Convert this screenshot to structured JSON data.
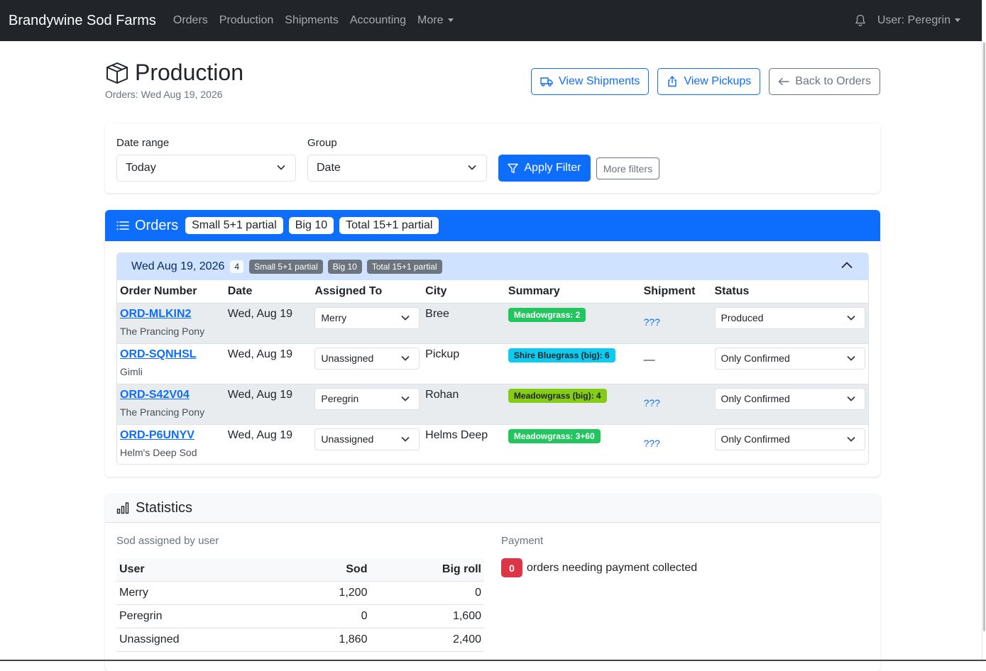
{
  "navbar": {
    "brand": "Brandywine Sod Farms",
    "links": [
      "Orders",
      "Production",
      "Shipments",
      "Accounting"
    ],
    "more_label": "More",
    "user_label": "User: Peregrin"
  },
  "header": {
    "title": "Production",
    "subtitle": "Orders: Wed Aug 19, 2026",
    "buttons": {
      "view_shipments": "View Shipments",
      "view_pickups": "View Pickups",
      "back_to_orders": "Back to Orders"
    }
  },
  "filters": {
    "date_range_label": "Date range",
    "date_range_value": "Today",
    "group_label": "Group",
    "group_value": "Date",
    "apply_label": "Apply Filter",
    "more_label": "More filters"
  },
  "orders": {
    "title": "Orders",
    "pills": [
      "Small 5+1 partial",
      "Big 10",
      "Total 15+1 partial"
    ],
    "group": {
      "date": "Wed Aug 19, 2026",
      "count": "4",
      "badges": [
        "Small 5+1 partial",
        "Big 10",
        "Total 15+1 partial"
      ]
    },
    "columns": [
      "Order Number",
      "Date",
      "Assigned To",
      "City",
      "Summary",
      "Shipment",
      "Status"
    ],
    "rows": [
      {
        "number": "ORD-MLKIN2",
        "customer": "The Prancing Pony",
        "date": "Wed, Aug 19",
        "assigned": "Merry",
        "city": "Bree",
        "summary": "Meadowgrass: 2",
        "summary_color": "#22c55e",
        "shipment": "???",
        "status": "Produced"
      },
      {
        "number": "ORD-SQNHSL",
        "customer": "Gimli",
        "date": "Wed, Aug 19",
        "assigned": "Unassigned",
        "city": "Pickup",
        "summary": "Shire Bluegrass (big): 6",
        "summary_color": "#0dcaf0",
        "shipment": "—",
        "status": "Only Confirmed"
      },
      {
        "number": "ORD-S42V04",
        "customer": "The Prancing Pony",
        "date": "Wed, Aug 19",
        "assigned": "Peregrin",
        "city": "Rohan",
        "summary": "Meadowgrass (big): 4",
        "summary_color": "#84cc16",
        "shipment": "???",
        "status": "Only Confirmed"
      },
      {
        "number": "ORD-P6UNYV",
        "customer": "Helm's Deep Sod",
        "date": "Wed, Aug 19",
        "assigned": "Unassigned",
        "city": "Helms Deep",
        "summary": "Meadowgrass: 3+60",
        "summary_color": "#22c55e",
        "shipment": "???",
        "status": "Only Confirmed"
      }
    ]
  },
  "statistics": {
    "title": "Statistics",
    "sod_caption": "Sod assigned by user",
    "columns": [
      "User",
      "Sod",
      "Big roll"
    ],
    "rows": [
      {
        "user": "Merry",
        "sod": "1,200",
        "big_roll": "0"
      },
      {
        "user": "Peregrin",
        "sod": "0",
        "big_roll": "1,600"
      },
      {
        "user": "Unassigned",
        "sod": "1,860",
        "big_roll": "2,400"
      }
    ],
    "payment_caption": "Payment",
    "payment_count": "0",
    "payment_text": "orders needing payment collected"
  }
}
